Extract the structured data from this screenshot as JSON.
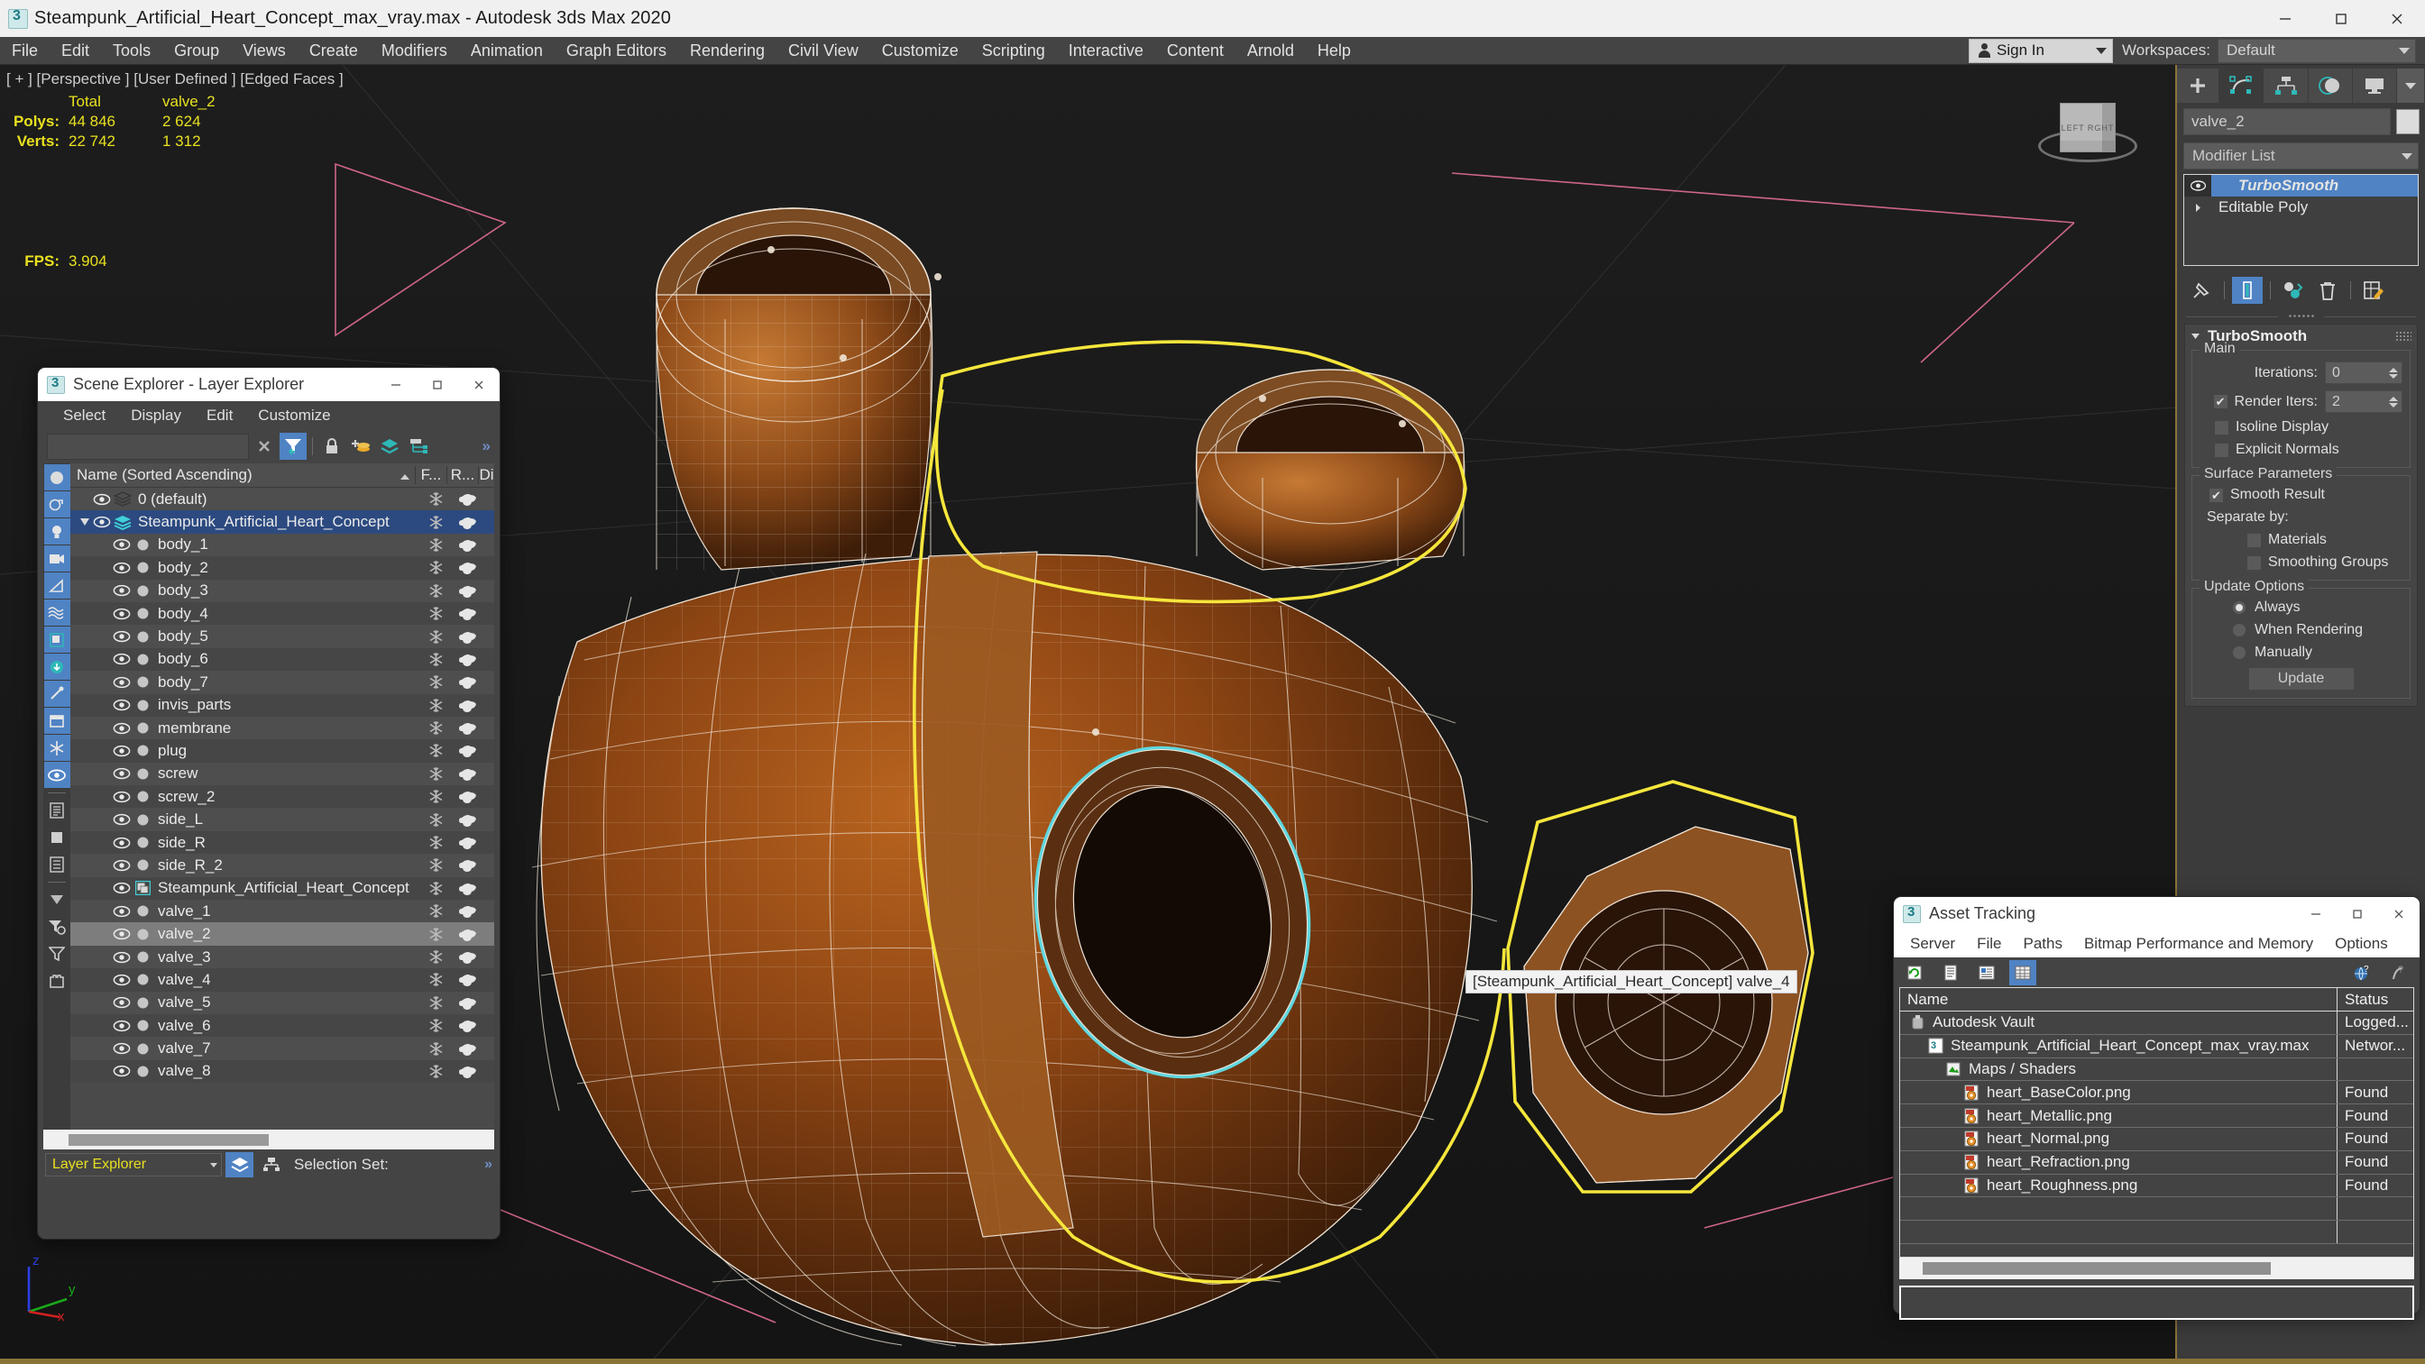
{
  "app": {
    "title": "Steampunk_Artificial_Heart_Concept_max_vray.max - Autodesk 3ds Max 2020",
    "icon": "3dsmax-icon",
    "minimize": "–",
    "maximize": "□",
    "close": "×"
  },
  "menubar": {
    "items": [
      {
        "label": "File"
      },
      {
        "label": "Edit"
      },
      {
        "label": "Tools"
      },
      {
        "label": "Group"
      },
      {
        "label": "Views"
      },
      {
        "label": "Create"
      },
      {
        "label": "Modifiers"
      },
      {
        "label": "Animation"
      },
      {
        "label": "Graph Editors"
      },
      {
        "label": "Rendering"
      },
      {
        "label": "Civil View"
      },
      {
        "label": "Customize"
      },
      {
        "label": "Scripting"
      },
      {
        "label": "Interactive"
      },
      {
        "label": "Content"
      },
      {
        "label": "Arnold"
      },
      {
        "label": "Help"
      }
    ],
    "signin_label": "Sign In",
    "workspaces_label": "Workspaces:",
    "workspace_value": "Default"
  },
  "viewport": {
    "hud": "[ + ] [Perspective ] [User Defined ] [Edged Faces ]",
    "stats": {
      "col_total": "Total",
      "col_object": "valve_2",
      "rows": [
        {
          "label": "Polys:",
          "total": "44 846",
          "object": "2 624"
        },
        {
          "label": "Verts:",
          "total": "22 742",
          "object": "1 312"
        }
      ],
      "fps_label": "FPS:",
      "fps_value": "3.904"
    },
    "object_label": "[Steampunk_Artificial_Heart_Concept] valve_4",
    "viewcube_faces": "LEFT  RGHT",
    "axis": {
      "x": "x",
      "y": "y",
      "z": "z"
    }
  },
  "scene_explorer": {
    "title": "Scene Explorer - Layer Explorer",
    "menus": [
      "Select",
      "Display",
      "Edit",
      "Customize"
    ],
    "search_value": "",
    "columns": {
      "name": "Name (Sorted Ascending)",
      "frozen": "F...",
      "render": "R...",
      "display": "Di"
    },
    "rows": [
      {
        "name": "0 (default)",
        "type": "layer",
        "depth": 0,
        "state": "normal"
      },
      {
        "name": "Steampunk_Artificial_Heart_Concept",
        "type": "layer-active",
        "depth": 0,
        "state": "selected"
      },
      {
        "name": "body_1",
        "type": "object",
        "depth": 1,
        "state": "normal"
      },
      {
        "name": "body_2",
        "type": "object",
        "depth": 1,
        "state": "normal"
      },
      {
        "name": "body_3",
        "type": "object",
        "depth": 1,
        "state": "normal"
      },
      {
        "name": "body_4",
        "type": "object",
        "depth": 1,
        "state": "normal"
      },
      {
        "name": "body_5",
        "type": "object",
        "depth": 1,
        "state": "normal"
      },
      {
        "name": "body_6",
        "type": "object",
        "depth": 1,
        "state": "normal"
      },
      {
        "name": "body_7",
        "type": "object",
        "depth": 1,
        "state": "normal"
      },
      {
        "name": "invis_parts",
        "type": "object",
        "depth": 1,
        "state": "normal"
      },
      {
        "name": "membrane",
        "type": "object",
        "depth": 1,
        "state": "normal"
      },
      {
        "name": "plug",
        "type": "object",
        "depth": 1,
        "state": "normal"
      },
      {
        "name": "screw",
        "type": "object",
        "depth": 1,
        "state": "normal"
      },
      {
        "name": "screw_2",
        "type": "object",
        "depth": 1,
        "state": "normal"
      },
      {
        "name": "side_L",
        "type": "object",
        "depth": 1,
        "state": "normal"
      },
      {
        "name": "side_R",
        "type": "object",
        "depth": 1,
        "state": "normal"
      },
      {
        "name": "side_R_2",
        "type": "object",
        "depth": 1,
        "state": "normal"
      },
      {
        "name": "Steampunk_Artificial_Heart_Concept",
        "type": "group",
        "depth": 1,
        "state": "normal"
      },
      {
        "name": "valve_1",
        "type": "object",
        "depth": 1,
        "state": "normal"
      },
      {
        "name": "valve_2",
        "type": "object",
        "depth": 1,
        "state": "highlight"
      },
      {
        "name": "valve_3",
        "type": "object",
        "depth": 1,
        "state": "normal"
      },
      {
        "name": "valve_4",
        "type": "object",
        "depth": 1,
        "state": "normal"
      },
      {
        "name": "valve_5",
        "type": "object",
        "depth": 1,
        "state": "normal"
      },
      {
        "name": "valve_6",
        "type": "object",
        "depth": 1,
        "state": "normal"
      },
      {
        "name": "valve_7",
        "type": "object",
        "depth": 1,
        "state": "normal"
      },
      {
        "name": "valve_8",
        "type": "object",
        "depth": 1,
        "state": "normal"
      }
    ],
    "footer": {
      "explorer_name": "Layer Explorer",
      "selection_set_label": "Selection Set:",
      "chevron": "»"
    }
  },
  "command_panel": {
    "object_name": "valve_2",
    "modifier_list_label": "Modifier List",
    "stack": [
      {
        "label": "TurboSmooth",
        "selected": true
      },
      {
        "label": "Editable Poly",
        "selected": false
      }
    ],
    "rollout": {
      "title": "TurboSmooth",
      "main_group": "Main",
      "iterations_label": "Iterations:",
      "iterations_value": "0",
      "render_iters_label": "Render Iters:",
      "render_iters_value": "2",
      "render_iters_checked": true,
      "isoline_label": "Isoline Display",
      "isoline_checked": false,
      "explicit_normals_label": "Explicit Normals",
      "explicit_normals_checked": false,
      "surface_group": "Surface Parameters",
      "smooth_result_label": "Smooth Result",
      "smooth_result_checked": true,
      "separate_by_label": "Separate by:",
      "materials_label": "Materials",
      "materials_checked": false,
      "smoothing_groups_label": "Smoothing Groups",
      "smoothing_groups_checked": false,
      "update_group": "Update Options",
      "always_label": "Always",
      "when_rendering_label": "When Rendering",
      "manually_label": "Manually",
      "update_mode": "Always",
      "update_button": "Update"
    }
  },
  "asset_tracking": {
    "title": "Asset Tracking",
    "menus": [
      "Server",
      "File",
      "Paths",
      "Bitmap Performance and Memory",
      "Options"
    ],
    "columns": {
      "name": "Name",
      "status": "Status"
    },
    "rows": [
      {
        "name": "Autodesk Vault",
        "status": "Logged...",
        "icon": "vault-icon",
        "depth": 0
      },
      {
        "name": "Steampunk_Artificial_Heart_Concept_max_vray.max",
        "status": "Networ...",
        "icon": "max-file-icon",
        "depth": 1
      },
      {
        "name": "Maps / Shaders",
        "status": "",
        "icon": "maps-icon",
        "depth": 2
      },
      {
        "name": "heart_BaseColor.png",
        "status": "Found",
        "icon": "png-icon",
        "depth": 3
      },
      {
        "name": "heart_Metallic.png",
        "status": "Found",
        "icon": "png-icon",
        "depth": 3
      },
      {
        "name": "heart_Normal.png",
        "status": "Found",
        "icon": "png-icon",
        "depth": 3
      },
      {
        "name": "heart_Refraction.png",
        "status": "Found",
        "icon": "png-icon",
        "depth": 3
      },
      {
        "name": "heart_Roughness.png",
        "status": "Found",
        "icon": "png-icon",
        "depth": 3
      },
      {
        "name": "",
        "status": "",
        "icon": "",
        "depth": 0
      },
      {
        "name": "",
        "status": "",
        "icon": "",
        "depth": 0
      }
    ]
  },
  "colors": {
    "accent_blue": "#4f83c4",
    "selection_yellow": "#f5e63c",
    "selection_cyan": "#5fd8e0",
    "stat_yellow": "#e8e020",
    "model_brown": "#8a4a18",
    "window_chrome": "#444444",
    "gold_border": "#8a7438"
  }
}
